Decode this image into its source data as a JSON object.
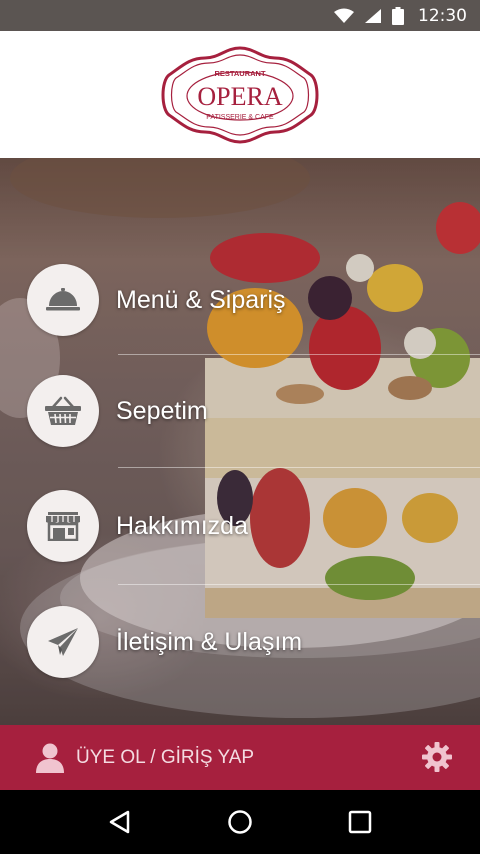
{
  "status_bar": {
    "time": "12:30"
  },
  "brand": {
    "top_text": "RESTAURANT",
    "name": "OPERA",
    "bottom_text": "PATISSERIE & CAFE",
    "color": "#a6203e"
  },
  "menu": {
    "items": [
      {
        "label": "Menü & Sipariş",
        "icon": "cloche-icon"
      },
      {
        "label": "Sepetim",
        "icon": "basket-icon"
      },
      {
        "label": "Hakkımızda",
        "icon": "storefront-icon"
      },
      {
        "label": "İletişim & Ulaşım",
        "icon": "paper-plane-icon"
      }
    ]
  },
  "account": {
    "label": "ÜYE OL / GİRİŞ YAP",
    "icon": "user-icon"
  },
  "settings": {
    "icon": "gear-icon"
  },
  "nav": {
    "back": "back-icon",
    "home": "home-icon",
    "recents": "recents-icon"
  },
  "colors": {
    "accent": "#a6203e",
    "circle_bg": "#f3efee",
    "icon_gray": "#6b6b6b"
  }
}
